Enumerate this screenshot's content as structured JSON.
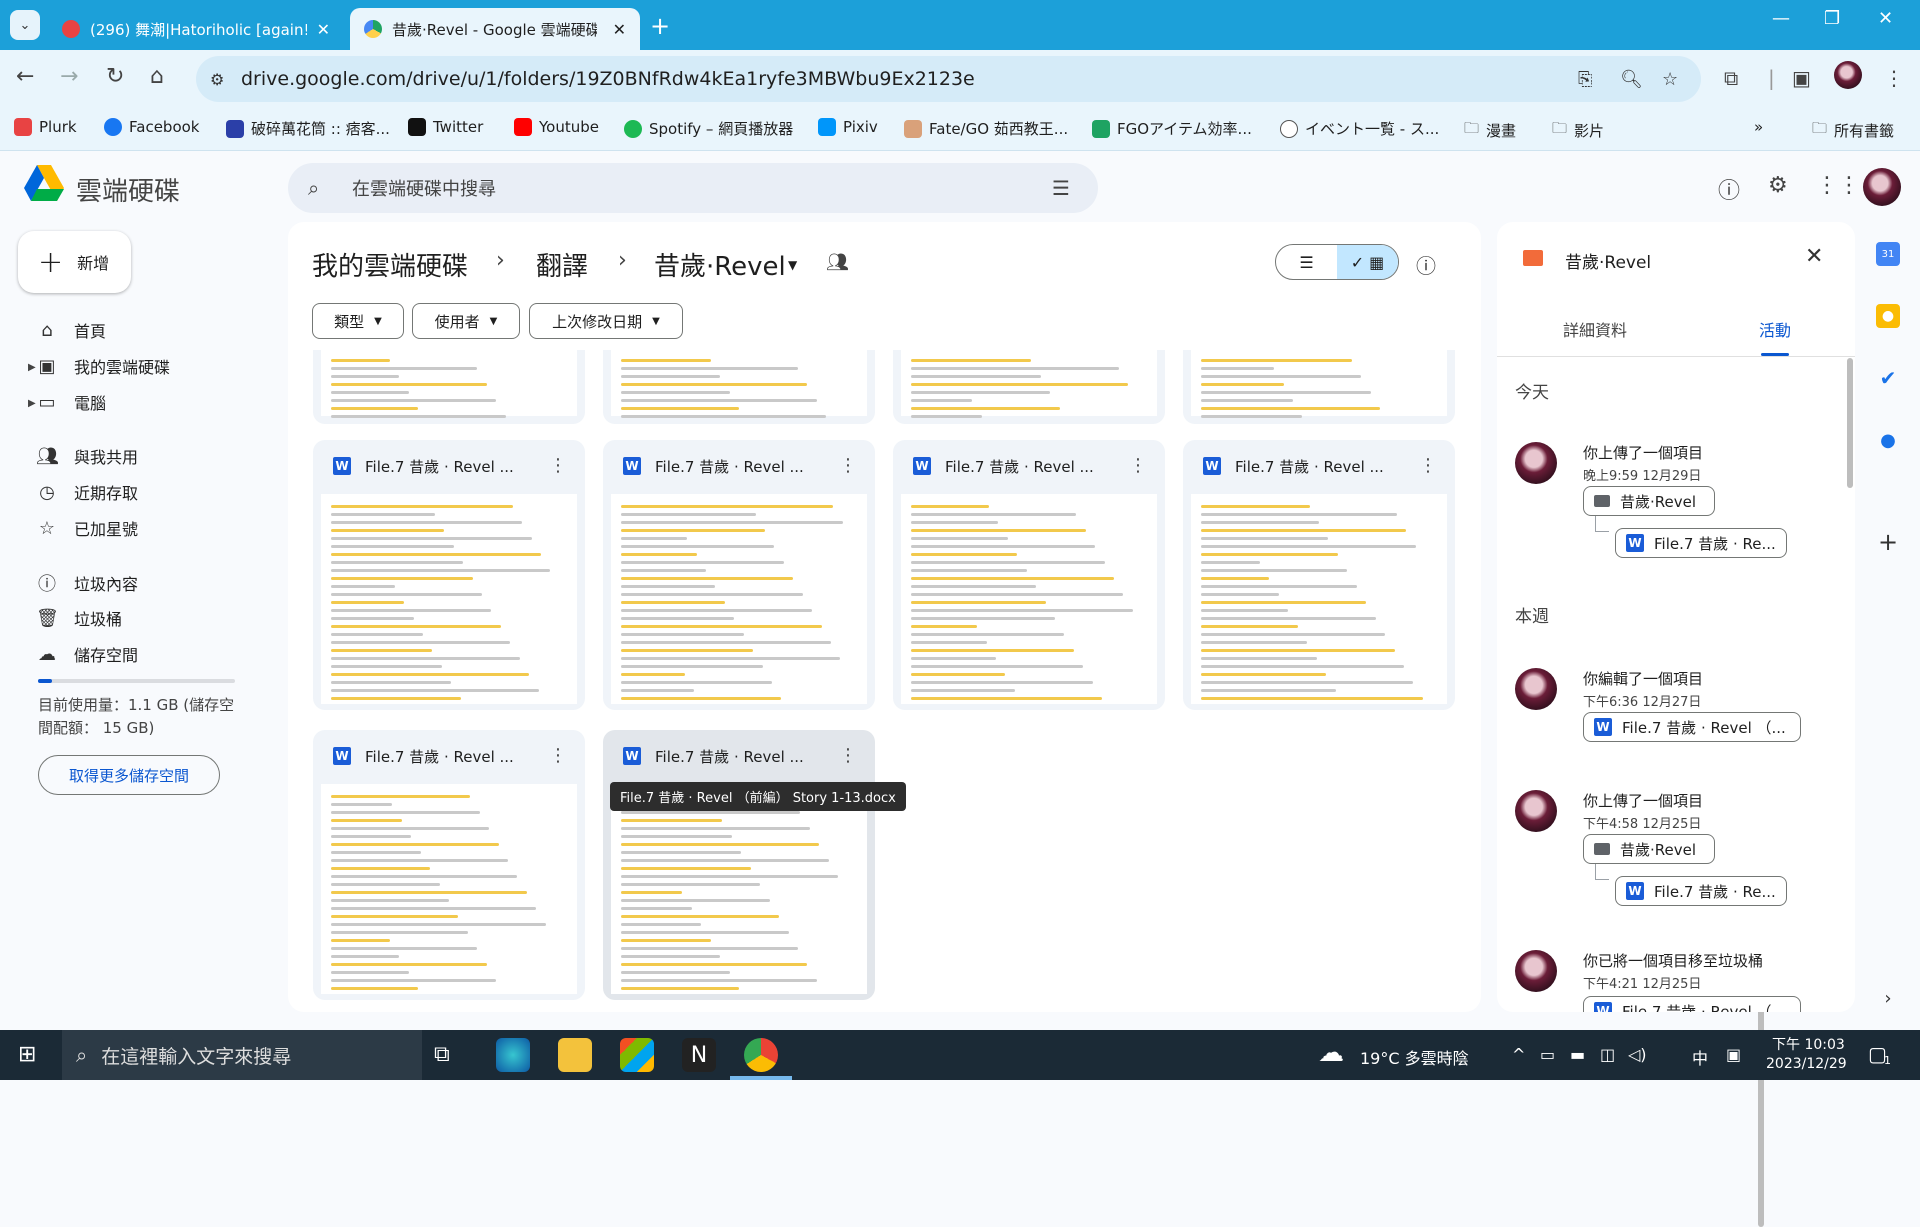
{
  "browser": {
    "tabs": [
      {
        "title": "(296) 舞潮|Hatoriholic [again!",
        "active": false
      },
      {
        "title": "昔歲·Revel - Google 雲端硬碟",
        "active": true
      }
    ],
    "url": "drive.google.com/drive/u/1/folders/19Z0BNfRdw4kEa1ryfe3MBWbu9Ex2123e",
    "bookmarks": [
      "Plurk",
      "Facebook",
      "破碎萬花筒 :: 痞客...",
      "Twitter",
      "Youtube",
      "Spotify – 網頁播放器",
      "Pixiv",
      "Fate/GO 茹西教王...",
      "FGOアイテム効率...",
      "イベント一覧 - ス...",
      "漫畫",
      "影片"
    ],
    "all_bookmarks": "所有書籤",
    "overflow": "»"
  },
  "drive": {
    "brand": "雲端硬碟",
    "search_placeholder": "在雲端硬碟中搜尋",
    "new_label": "新增",
    "nav": {
      "home": "首頁",
      "my_drive": "我的雲端硬碟",
      "computers": "電腦",
      "shared": "與我共用",
      "recent": "近期存取",
      "starred": "已加星號",
      "spam": "垃圾內容",
      "trash": "垃圾桶",
      "storage": "儲存空間"
    },
    "storage_text": "目前使用量：1.1 GB (儲存空間配額： 15 GB)",
    "storage_fraction": 0.07,
    "more_storage": "取得更多儲存空間",
    "breadcrumb": [
      "我的雲端硬碟",
      "翻譯",
      "昔歲·Revel"
    ],
    "filters": [
      "類型",
      "使用者",
      "上次修改日期"
    ],
    "file_name": "File.7 昔歲 · Revel ...",
    "tooltip": "File.7 昔歲 · Revel （前編） Story 1-13.docx"
  },
  "details": {
    "title": "昔歲·Revel",
    "tabs": [
      "詳細資料",
      "活動"
    ],
    "sections": {
      "today": "今天",
      "week": "本週"
    },
    "activities": [
      {
        "title": "你上傳了一個項目",
        "time": "晚上9:59 12月29日",
        "chips": [
          "昔歲·Revel",
          "File.7 昔歲 · Re..."
        ]
      },
      {
        "title": "你編輯了一個項目",
        "time": "下午6:36 12月27日",
        "chips": [
          "File.7 昔歲 · Revel （..."
        ]
      },
      {
        "title": "你上傳了一個項目",
        "time": "下午4:58 12月25日",
        "chips": [
          "昔歲·Revel",
          "File.7 昔歲 · Re..."
        ]
      },
      {
        "title": "你已將一個項目移至垃圾桶",
        "time": "下午4:21 12月25日",
        "chips": [
          "File.7 昔歲 · Revel （"
        ]
      }
    ]
  },
  "taskbar": {
    "search_placeholder": "在這裡輸入文字來搜尋",
    "weather": "19°C 多雲時陰",
    "ime": "中",
    "time": "下午 10:03",
    "date": "2023/12/29",
    "notification_count": "1"
  },
  "colors": {
    "tabstrip": "#1ca0d9",
    "toolbar": "#e9f5fc",
    "accent": "#0b57d0",
    "word": "#1a5cd7"
  }
}
